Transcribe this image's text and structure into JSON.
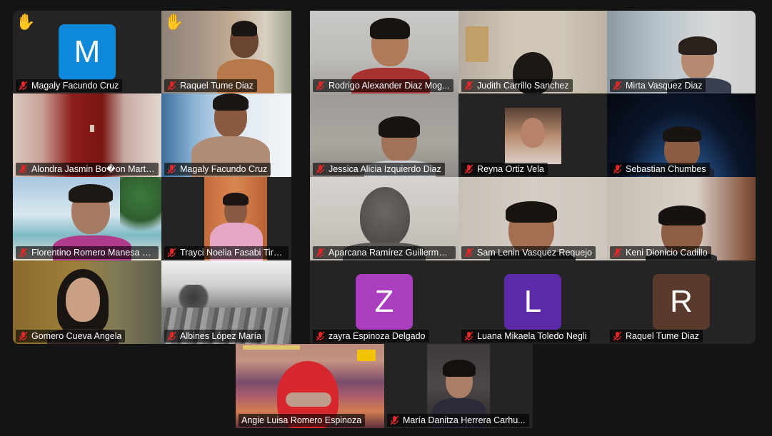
{
  "participants": [
    {
      "name": "Magaly Facundo Cruz",
      "type": "avatar",
      "initial": "M",
      "avatar_color": "#0e88d8",
      "hand_raised": true
    },
    {
      "name": "Raquel Tume Diaz",
      "type": "video",
      "hand_raised": true
    },
    {
      "name": "Rodrigo Alexander Diaz Mog...",
      "type": "video"
    },
    {
      "name": "Judith Carrillo Sanchez",
      "type": "video"
    },
    {
      "name": "Mirta Vasquez Diaz",
      "type": "video"
    },
    {
      "name": "Alondra Jasmin Bo�on Marti...",
      "type": "video"
    },
    {
      "name": "Magaly Facundo Cruz",
      "type": "video"
    },
    {
      "name": "Jessica Alicia Izquierdo Diaz",
      "type": "video"
    },
    {
      "name": "Reyna Ortiz Vela",
      "type": "video"
    },
    {
      "name": "Sebastian Chumbes",
      "type": "video"
    },
    {
      "name": "Florentino Romero Manesa Luli",
      "type": "video"
    },
    {
      "name": "Trayci Noelia Fasabi Tirado",
      "type": "video"
    },
    {
      "name": "Aparcana Ramírez Guillermo ...",
      "type": "video"
    },
    {
      "name": "Sam Lenin Vasquez Requejo",
      "type": "video"
    },
    {
      "name": "Keni Dionicio Cadillo",
      "type": "video"
    },
    {
      "name": "Gomero Cueva Angela",
      "type": "video"
    },
    {
      "name": "Albines López María",
      "type": "video"
    },
    {
      "name": "zayra Espinoza Delgado",
      "type": "avatar",
      "initial": "Z",
      "avatar_color": "#a93fbe"
    },
    {
      "name": "Luana Mikaela Toledo Negli",
      "type": "avatar",
      "initial": "L",
      "avatar_color": "#5c2aa9"
    },
    {
      "name": "Raquel Tume Diaz",
      "type": "avatar",
      "initial": "R",
      "avatar_color": "#5b3a2e"
    },
    {
      "name": "Angie Luisa Romero Espinoza",
      "type": "video",
      "active_speaker": true
    },
    {
      "name": "María Danitza Herrera Carhu...",
      "type": "video"
    }
  ],
  "icons": {
    "mic_muted": "muted-microphone-icon",
    "hand": "raised-hand-icon"
  },
  "colors": {
    "background": "#141414",
    "tile": "#242424",
    "active_speaker_border": "#23d959",
    "mute_red": "#e02828"
  }
}
